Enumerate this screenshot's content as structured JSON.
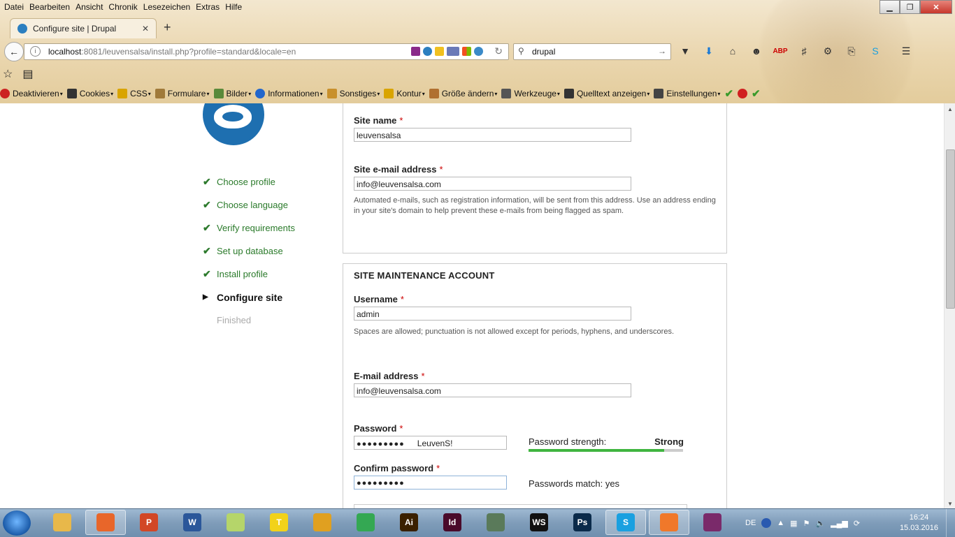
{
  "menu": [
    "Datei",
    "Bearbeiten",
    "Ansicht",
    "Chronik",
    "Lesezeichen",
    "Extras",
    "Hilfe"
  ],
  "tab": {
    "title": "Configure site | Drupal"
  },
  "address": {
    "host": "localhost",
    "rest": ":8081/leuvensalsa/install.php?profile=standard&locale=en"
  },
  "search": {
    "query": "drupal"
  },
  "devtoolbar": [
    {
      "label": "Deaktivieren",
      "color": "#cc2222"
    },
    {
      "label": "Cookies",
      "color": "#333333"
    },
    {
      "label": "CSS",
      "color": "#d9a400"
    },
    {
      "label": "Formulare",
      "color": "#a07a3a"
    },
    {
      "label": "Bilder",
      "color": "#5a8a3a"
    },
    {
      "label": "Informationen",
      "color": "#2266cc"
    },
    {
      "label": "Sonstiges",
      "color": "#c8902c"
    },
    {
      "label": "Kontur",
      "color": "#d9a400"
    },
    {
      "label": "Größe ändern",
      "color": "#b07030"
    },
    {
      "label": "Werkzeuge",
      "color": "#555555"
    },
    {
      "label": "Quelltext anzeigen",
      "color": "#333333"
    },
    {
      "label": "Einstellungen",
      "color": "#444444"
    }
  ],
  "steps": [
    {
      "label": "Choose profile",
      "state": "done"
    },
    {
      "label": "Choose language",
      "state": "done"
    },
    {
      "label": "Verify requirements",
      "state": "done"
    },
    {
      "label": "Set up database",
      "state": "done"
    },
    {
      "label": "Install profile",
      "state": "done"
    },
    {
      "label": "Configure site",
      "state": "active"
    },
    {
      "label": "Finished",
      "state": "todo"
    }
  ],
  "site": {
    "name_label": "Site name",
    "name_value": "leuvensalsa",
    "email_label": "Site e-mail address",
    "email_value": "info@leuvensalsa.com",
    "email_desc": "Automated e-mails, such as registration information, will be sent from this address. Use an address ending in your site's domain to help prevent these e-mails from being flagged as spam."
  },
  "account": {
    "section_title": "SITE MAINTENANCE ACCOUNT",
    "username_label": "Username",
    "username_value": "admin",
    "username_desc": "Spaces are allowed; punctuation is not allowed except for periods, hyphens, and underscores.",
    "email_label": "E-mail address",
    "email_value": "info@leuvensalsa.com",
    "password_label": "Password",
    "password_mask": "●●●●●●●●●",
    "password_hint": "LeuvenS!",
    "confirm_label": "Confirm password",
    "confirm_mask": "●●●●●●●●●",
    "strength_label": "Password strength:",
    "strength_value": "Strong",
    "strength_fraction": 0.88,
    "match_text": "Passwords match: yes"
  },
  "required_mark": "*",
  "taskbar": {
    "lang": "DE",
    "time": "16:24",
    "date": "15.03.2016",
    "apps": [
      {
        "name": "explorer",
        "color": "#e8b84a",
        "text": ""
      },
      {
        "name": "firefox",
        "color": "#e8662a",
        "text": "",
        "active": true
      },
      {
        "name": "powerpoint",
        "color": "#d24726",
        "text": "P"
      },
      {
        "name": "word",
        "color": "#2b579a",
        "text": "W"
      },
      {
        "name": "notes",
        "color": "#b5d56a",
        "text": ""
      },
      {
        "name": "typora",
        "color": "#f2d21a",
        "text": "T"
      },
      {
        "name": "tools",
        "color": "#e0a020",
        "text": ""
      },
      {
        "name": "chrome",
        "color": "#34a853",
        "text": ""
      },
      {
        "name": "illustrator",
        "color": "#3a2000",
        "text": "Ai"
      },
      {
        "name": "indesign",
        "color": "#4a0a2a",
        "text": "Id"
      },
      {
        "name": "evernote",
        "color": "#5a7a5a",
        "text": ""
      },
      {
        "name": "webstorm",
        "color": "#111111",
        "text": "WS"
      },
      {
        "name": "photoshop",
        "color": "#0a2a4a",
        "text": "Ps"
      },
      {
        "name": "skype",
        "color": "#1aa0e0",
        "text": "S",
        "active": true
      },
      {
        "name": "xampp",
        "color": "#f0782a",
        "text": "",
        "active": true
      },
      {
        "name": "winrar",
        "color": "#7a2a6a",
        "text": ""
      }
    ]
  }
}
